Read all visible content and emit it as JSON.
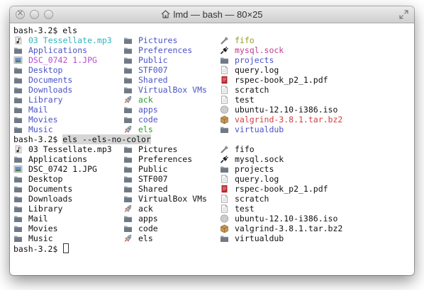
{
  "window": {
    "title": "lmd — bash — 80×25"
  },
  "colors": {
    "mp3": "#2fb4c0",
    "dir": "#4b53c7",
    "jpg": "#b84bd1",
    "exec": "#2a9e2a",
    "socket": "#c23a8f",
    "fifo": "#9a9a2a",
    "archive": "#d14040",
    "plain": "#111111"
  },
  "terminal": {
    "prompt": "bash-3.2$ ",
    "cmd1": "els",
    "cmd2": "els --els-no-color",
    "listing": [
      [
        {
          "name": "03 Tessellate.mp3",
          "icon": "music-file-icon",
          "color": "mp3"
        },
        {
          "name": "Pictures",
          "icon": "folder-icon",
          "color": "dir"
        },
        {
          "name": "fifo",
          "icon": "pipe-icon",
          "color": "fifo"
        }
      ],
      [
        {
          "name": "Applications",
          "icon": "folder-icon",
          "color": "dir"
        },
        {
          "name": "Preferences",
          "icon": "folder-icon",
          "color": "dir"
        },
        {
          "name": "mysql.sock",
          "icon": "plug-icon",
          "color": "socket"
        }
      ],
      [
        {
          "name": "DSC_0742 1.JPG",
          "icon": "image-file-icon",
          "color": "jpg"
        },
        {
          "name": "Public",
          "icon": "folder-icon",
          "color": "dir"
        },
        {
          "name": "projects",
          "icon": "folder-icon",
          "color": "dir"
        }
      ],
      [
        {
          "name": "Desktop",
          "icon": "folder-icon",
          "color": "dir"
        },
        {
          "name": "STF007",
          "icon": "folder-icon",
          "color": "dir"
        },
        {
          "name": "query.log",
          "icon": "document-icon",
          "color": "plain"
        }
      ],
      [
        {
          "name": "Documents",
          "icon": "folder-icon",
          "color": "dir"
        },
        {
          "name": "Shared",
          "icon": "folder-icon",
          "color": "dir"
        },
        {
          "name": "rspec-book_p2_1.pdf",
          "icon": "pdf-file-icon",
          "color": "plain"
        }
      ],
      [
        {
          "name": "Downloads",
          "icon": "folder-icon",
          "color": "dir"
        },
        {
          "name": "VirtualBox VMs",
          "icon": "folder-icon",
          "color": "dir"
        },
        {
          "name": "scratch",
          "icon": "document-icon",
          "color": "plain"
        }
      ],
      [
        {
          "name": "Library",
          "icon": "folder-icon",
          "color": "dir"
        },
        {
          "name": "ack",
          "icon": "rocket-icon",
          "color": "exec"
        },
        {
          "name": "test",
          "icon": "document-icon",
          "color": "plain"
        }
      ],
      [
        {
          "name": "Mail",
          "icon": "folder-icon",
          "color": "dir"
        },
        {
          "name": "apps",
          "icon": "folder-icon",
          "color": "dir"
        },
        {
          "name": "ubuntu-12.10-i386.iso",
          "icon": "disc-image-icon",
          "color": "plain"
        }
      ],
      [
        {
          "name": "Movies",
          "icon": "folder-icon",
          "color": "dir"
        },
        {
          "name": "code",
          "icon": "folder-icon",
          "color": "dir"
        },
        {
          "name": "valgrind-3.8.1.tar.bz2",
          "icon": "package-icon",
          "color": "archive"
        }
      ],
      [
        {
          "name": "Music",
          "icon": "folder-icon",
          "color": "dir"
        },
        {
          "name": "els",
          "icon": "rocket-icon",
          "color": "exec"
        },
        {
          "name": "virtualdub",
          "icon": "folder-icon",
          "color": "dir"
        }
      ]
    ]
  }
}
